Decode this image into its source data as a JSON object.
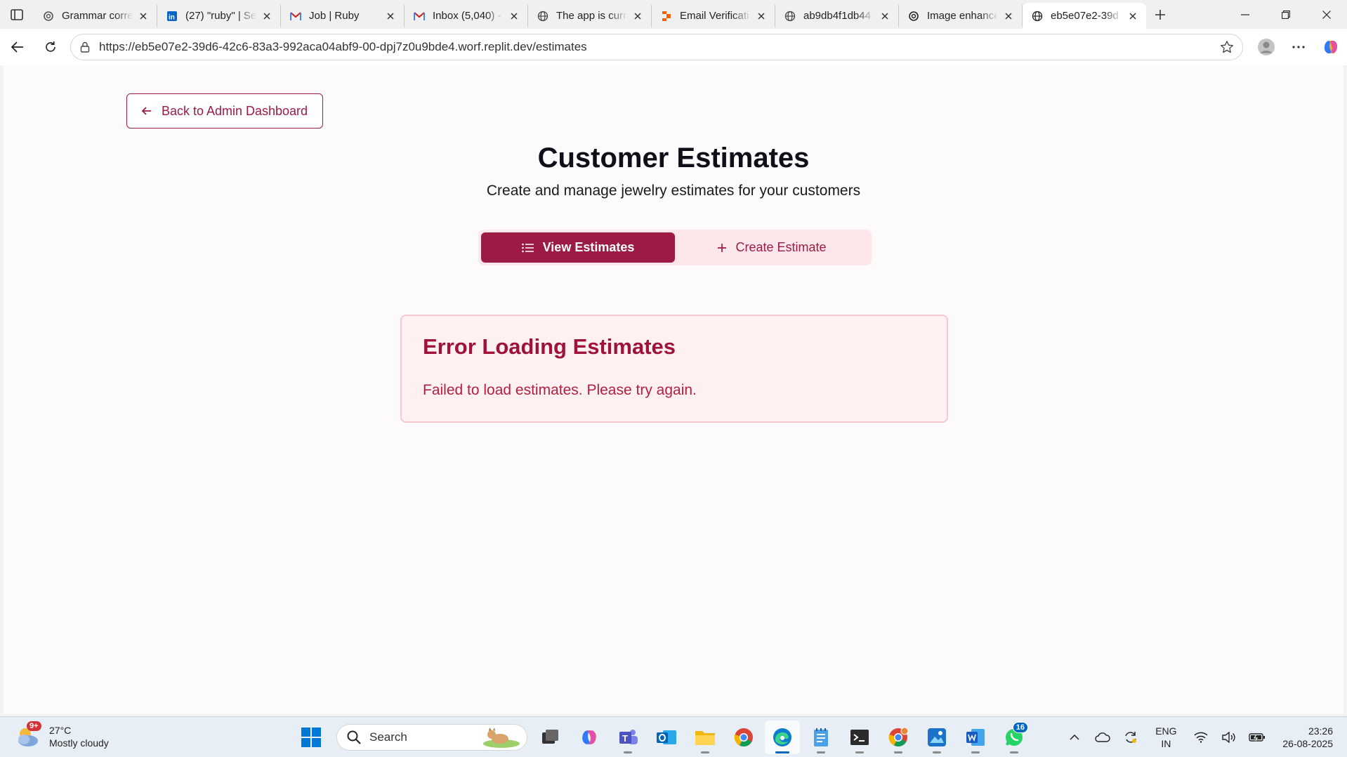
{
  "browser": {
    "tabs": [
      {
        "title": "Grammar corre",
        "icon": "openai-icon"
      },
      {
        "title": "(27) \"ruby\" | Se",
        "icon": "linkedin-icon"
      },
      {
        "title": "Job | Ruby",
        "icon": "gmail-icon"
      },
      {
        "title": "Inbox (5,040) -",
        "icon": "gmail-icon"
      },
      {
        "title": "The app is curr",
        "icon": "globe-icon"
      },
      {
        "title": "Email Verificati",
        "icon": "replit-icon"
      },
      {
        "title": "ab9db4f1db44",
        "icon": "globe-icon"
      },
      {
        "title": "Image enhance",
        "icon": "openai-icon"
      },
      {
        "title": "eb5e07e2-39d",
        "icon": "globe-icon",
        "active": true
      }
    ],
    "url": "https://eb5e07e2-39d6-42c6-83a3-992aca04abf9-00-dpj7z0u9bde4.worf.replit.dev/estimates"
  },
  "page": {
    "back_label": "Back to Admin Dashboard",
    "title": "Customer Estimates",
    "subtitle": "Create and manage jewelry estimates for your customers",
    "tabs": {
      "view": "View Estimates",
      "create": "Create Estimate"
    },
    "error": {
      "title": "Error Loading Estimates",
      "message": "Failed to load estimates. Please try again."
    },
    "colors": {
      "accent": "#9b1b44",
      "error_bg": "#fff1f2",
      "error_text": "#9f1239"
    }
  },
  "taskbar": {
    "weather": {
      "temp": "27°C",
      "condition": "Mostly cloudy",
      "badge": "9+"
    },
    "search_placeholder": "Search",
    "whatsapp_badge": "16",
    "lang_line1": "ENG",
    "lang_line2": "IN",
    "time": "23:26",
    "date": "26-08-2025"
  }
}
